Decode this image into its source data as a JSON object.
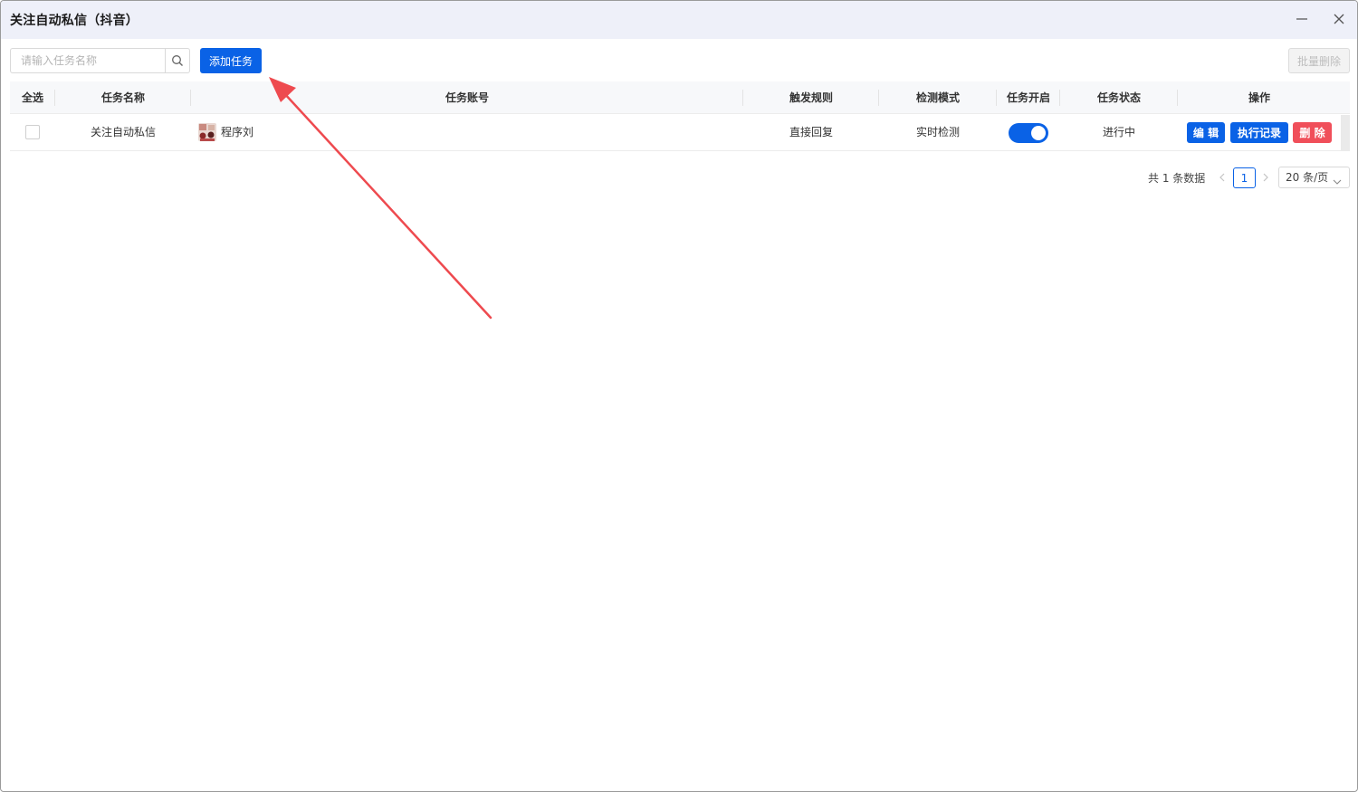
{
  "window": {
    "title": "关注自动私信（抖音）",
    "minimize_icon": "minimize-icon",
    "close_icon": "close-icon"
  },
  "toolbar": {
    "search_placeholder": "请输入任务名称",
    "search_value": "",
    "search_icon": "search-icon",
    "add_label": "添加任务",
    "batch_delete_label": "批量删除"
  },
  "table": {
    "columns": [
      "全选",
      "任务名称",
      "任务账号",
      "触发规则",
      "检测模式",
      "任务开启",
      "任务状态",
      "操作"
    ],
    "rows": [
      {
        "checked": false,
        "name": "关注自动私信",
        "account": "程序刘",
        "trigger": "直接回复",
        "detect": "实时检测",
        "enabled": true,
        "status": "进行中",
        "actions": [
          "编 辑",
          "执行记录",
          "删 除"
        ]
      }
    ]
  },
  "pagination": {
    "total_text": "共 1 条数据",
    "current_page": "1",
    "page_size": "20 条/页"
  },
  "colors": {
    "primary": "#0a62e6",
    "danger": "#f04f5a",
    "annotation_arrow": "#ee4a4f",
    "titlebar_bg": "#eef0f9"
  }
}
